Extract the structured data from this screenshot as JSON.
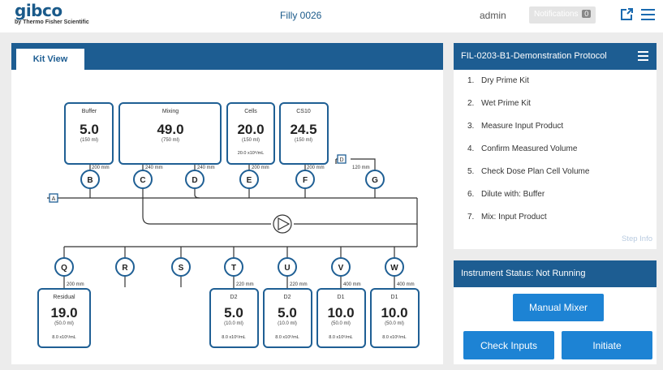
{
  "header": {
    "logo_main": "gibco",
    "logo_sub": "by Thermo Fisher Scientific",
    "title": "Filly 0026",
    "user": "admin",
    "notifications_label": "Notifications",
    "notifications_count": "0"
  },
  "kit": {
    "tab_label": "Kit View",
    "top_bags": [
      {
        "label": "Buffer",
        "value": "5.0",
        "capacity": "(150 ml)",
        "extra": ""
      },
      {
        "label": "Mixing",
        "value": "49.0",
        "capacity": "(750 ml)",
        "extra": ""
      },
      {
        "label": "Cells",
        "value": "20.0",
        "capacity": "(150 ml)",
        "extra": "20.0 x10⁶/mL"
      },
      {
        "label": "CS10",
        "value": "24.5",
        "capacity": "(150 ml)",
        "extra": ""
      }
    ],
    "top_lines": [
      "200 mm",
      "240 mm",
      "240 mm",
      "200 mm",
      "200 mm",
      "120 mm"
    ],
    "top_valves": [
      "B",
      "C",
      "D",
      "E",
      "F",
      "G"
    ],
    "port_labels": [
      "A",
      "D"
    ],
    "bottom_valves": [
      "Q",
      "R",
      "S",
      "T",
      "U",
      "V",
      "W"
    ],
    "bottom_lines": [
      "200 mm",
      "220 mm",
      "220 mm",
      "400 mm",
      "400 mm"
    ],
    "bottom_bags": [
      {
        "label": "Residual",
        "value": "19.0",
        "capacity": "(50.0 ml)",
        "extra": "8.0 x10⁶/mL"
      },
      {
        "label": "D2",
        "value": "5.0",
        "capacity": "(10.0 ml)",
        "extra": "8.0 x10⁶/mL"
      },
      {
        "label": "D2",
        "value": "5.0",
        "capacity": "(10.0 ml)",
        "extra": "8.0 x10⁶/mL"
      },
      {
        "label": "D1",
        "value": "10.0",
        "capacity": "(50.0 ml)",
        "extra": "8.0 x10⁶/mL"
      },
      {
        "label": "D1",
        "value": "10.0",
        "capacity": "(50.0 ml)",
        "extra": "8.0 x10⁶/mL"
      }
    ]
  },
  "protocol": {
    "title": "FIL-0203-B1-Demonstration Protocol",
    "steps": [
      {
        "num": "1.",
        "label": "Dry Prime Kit"
      },
      {
        "num": "2.",
        "label": "Wet Prime Kit"
      },
      {
        "num": "3.",
        "label": "Measure Input Product"
      },
      {
        "num": "4.",
        "label": "Confirm Measured Volume"
      },
      {
        "num": "5.",
        "label": "Check Dose Plan Cell Volume"
      },
      {
        "num": "6.",
        "label": "Dilute with: Buffer"
      },
      {
        "num": "7.",
        "label": "Mix: Input Product"
      }
    ],
    "step_info": "Step Info"
  },
  "status": {
    "title": "Instrument Status: Not Running",
    "manual_mixer": "Manual Mixer",
    "check_inputs": "Check Inputs",
    "initiate": "Initiate"
  },
  "colors": {
    "primary": "#1d5d92",
    "button": "#1d83d4",
    "bag_border": "#1f5f94"
  }
}
